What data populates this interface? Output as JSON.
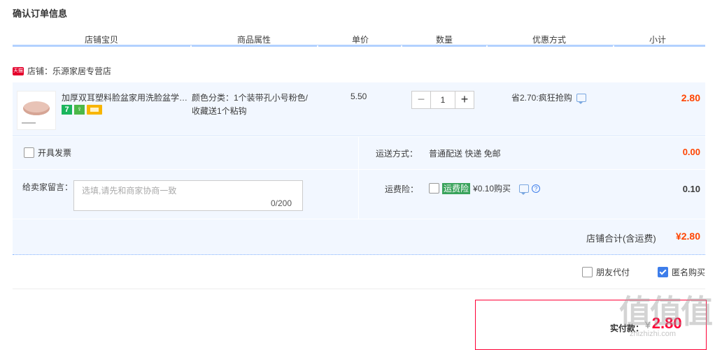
{
  "page_title": "确认订单信息",
  "columns": [
    "店铺宝贝",
    "商品属性",
    "单价",
    "数量",
    "优惠方式",
    "小计"
  ],
  "shop": {
    "badge": "天猫",
    "name": "店铺：乐源家居专营店"
  },
  "item": {
    "title": "加厚双耳塑料脸盆家用洗脸盆学…",
    "badge_7": "7",
    "badge_guard": "♀",
    "attr_line1": "颜色分类：1个装带孔小号粉色/",
    "attr_line2": "收藏送1个粘钩",
    "price": "5.50",
    "qty_minus": "−",
    "qty": "1",
    "qty_plus": "+",
    "promo": "省2.70:疯狂抢购",
    "subtotal": "2.80"
  },
  "invoice": {
    "label": "开具发票"
  },
  "shipping": {
    "label": "运送方式：",
    "value": "普通配送 快递 免邮",
    "fee": "0.00"
  },
  "message": {
    "label": "给卖家留言：",
    "placeholder": "选填,请先和商家协商一致",
    "count": "0/200"
  },
  "insurance": {
    "label": "运费险：",
    "badge": "运费险",
    "text": "¥0.10购买",
    "q": "?",
    "fee": "0.10"
  },
  "shop_total": {
    "label": "店铺合计(含运费)",
    "value": "¥2.80"
  },
  "options": {
    "friend_pay": "朋友代付",
    "anonymous": "匿名购买"
  },
  "payment": {
    "label": "实付款：",
    "currency": "¥",
    "value": "2.80"
  },
  "watermark": {
    "big": "值值值",
    "small": "zhizhizhi.com"
  }
}
